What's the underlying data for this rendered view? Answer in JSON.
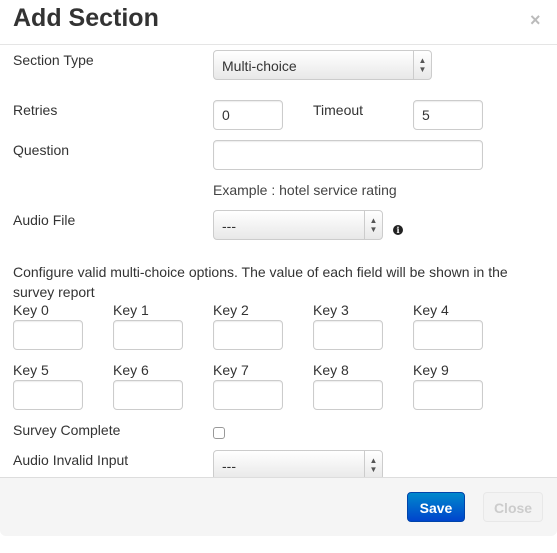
{
  "header": {
    "title": "Add Section",
    "close_glyph": "×"
  },
  "form": {
    "section_type": {
      "label": "Section Type",
      "value": "Multi-choice"
    },
    "retries": {
      "label": "Retries",
      "value": "0"
    },
    "timeout": {
      "label": "Timeout",
      "value": "5"
    },
    "question": {
      "label": "Question",
      "value": "",
      "help": "Example : hotel service rating"
    },
    "audio_file": {
      "label": "Audio File",
      "value": "---",
      "info_icon": "info-icon"
    },
    "options_help": "Configure valid multi-choice options. The value of each field will be shown in the survey report",
    "keys": [
      {
        "label": "Key 0",
        "value": ""
      },
      {
        "label": "Key 1",
        "value": ""
      },
      {
        "label": "Key 2",
        "value": ""
      },
      {
        "label": "Key 3",
        "value": ""
      },
      {
        "label": "Key 4",
        "value": ""
      },
      {
        "label": "Key 5",
        "value": ""
      },
      {
        "label": "Key 6",
        "value": ""
      },
      {
        "label": "Key 7",
        "value": ""
      },
      {
        "label": "Key 8",
        "value": ""
      },
      {
        "label": "Key 9",
        "value": ""
      }
    ],
    "survey_complete": {
      "label": "Survey Complete",
      "checked": false
    },
    "audio_invalid_input": {
      "label": "Audio Invalid Input",
      "value": "---"
    }
  },
  "footer": {
    "save_label": "Save",
    "close_label": "Close"
  },
  "colors": {
    "primary": "#0055cc",
    "footer_bg": "#f5f5f5"
  }
}
